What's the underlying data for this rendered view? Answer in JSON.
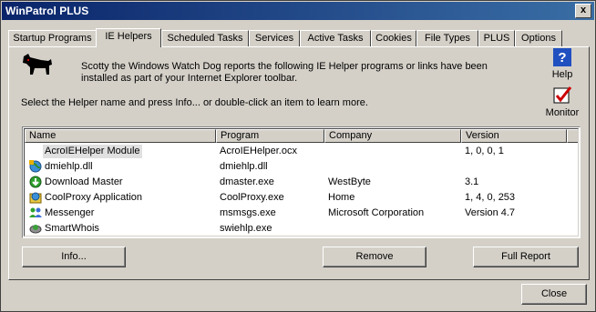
{
  "window": {
    "title": "WinPatrol PLUS",
    "close_glyph": "x"
  },
  "tabs": [
    {
      "label": "Startup Programs"
    },
    {
      "label": "IE Helpers"
    },
    {
      "label": "Scheduled Tasks"
    },
    {
      "label": "Services"
    },
    {
      "label": "Active Tasks"
    },
    {
      "label": "Cookies"
    },
    {
      "label": "File Types"
    },
    {
      "label": "PLUS"
    },
    {
      "label": "Options"
    }
  ],
  "active_tab": "IE Helpers",
  "panel": {
    "description": "Scotty the Windows Watch Dog reports the following IE Helper programs or links  have been installed as part of your Internet Explorer toolbar.",
    "instruction": "Select the Helper name and press Info... or double-click an item to learn more.",
    "help_label": "Help",
    "monitor_label": "Monitor"
  },
  "list": {
    "columns": [
      "Name",
      "Program",
      "Company",
      "Version"
    ],
    "rows": [
      {
        "name": "AcroIEHelper Module",
        "program": "AcroIEHelper.ocx",
        "company": "",
        "version": "1, 0, 0, 1",
        "icon": "none-icon"
      },
      {
        "name": "dmiehlp.dll",
        "program": "dmiehlp.dll",
        "company": "",
        "version": "",
        "icon": "globe-icon"
      },
      {
        "name": "Download Master",
        "program": "dmaster.exe",
        "company": "WestByte",
        "version": "3.1",
        "icon": "download-arrow-icon"
      },
      {
        "name": "CoolProxy Application",
        "program": "CoolProxy.exe",
        "company": "Home",
        "version": "1, 4, 0, 253",
        "icon": "proxy-icon"
      },
      {
        "name": "Messenger",
        "program": "msmsgs.exe",
        "company": "Microsoft Corporation",
        "version": "Version 4.7",
        "icon": "messenger-people-icon"
      },
      {
        "name": "SmartWhois",
        "program": "swiehlp.exe",
        "company": "",
        "version": "",
        "icon": "whois-globe-icon"
      }
    ]
  },
  "buttons": {
    "info": "Info...",
    "remove": "Remove",
    "full_report": "Full Report",
    "close": "Close"
  }
}
